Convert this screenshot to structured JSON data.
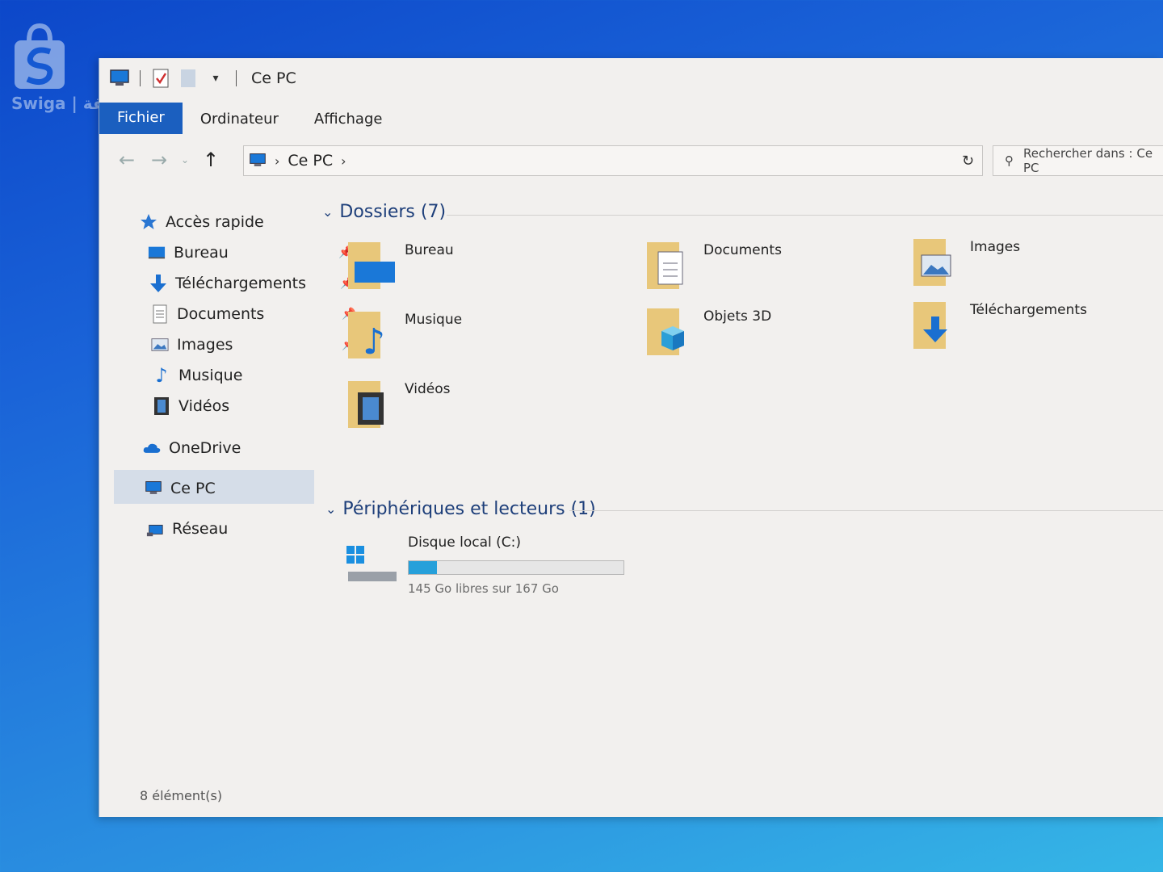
{
  "watermark": {
    "text": "Swiga | سويقة"
  },
  "window": {
    "title": "Ce PC",
    "quick_access_icons": [
      "computer-icon",
      "properties-icon",
      "new-folder-icon",
      "customize-dropdown-icon"
    ]
  },
  "ribbon": {
    "tabs": [
      {
        "label": "Fichier",
        "active": true
      },
      {
        "label": "Ordinateur",
        "active": false
      },
      {
        "label": "Affichage",
        "active": false
      }
    ]
  },
  "address": {
    "crumbs": [
      "Ce PC"
    ],
    "search_placeholder": "Rechercher dans : Ce PC"
  },
  "nav": {
    "quick_access": "Accès rapide",
    "items": [
      {
        "label": "Bureau",
        "icon": "desktop-icon",
        "pinned": true
      },
      {
        "label": "Téléchargements",
        "icon": "download-icon",
        "pinned": true
      },
      {
        "label": "Documents",
        "icon": "document-icon",
        "pinned": true
      },
      {
        "label": "Images",
        "icon": "image-icon",
        "pinned": true
      },
      {
        "label": "Musique",
        "icon": "music-icon",
        "pinned": false
      },
      {
        "label": "Vidéos",
        "icon": "video-icon",
        "pinned": false
      }
    ],
    "onedrive": "OneDrive",
    "this_pc": "Ce PC",
    "network": "Réseau"
  },
  "content": {
    "folders_header": "Dossiers (7)",
    "folders": [
      {
        "label": "Bureau",
        "icon": "desktop-folder-icon"
      },
      {
        "label": "Documents",
        "icon": "documents-folder-icon"
      },
      {
        "label": "Images",
        "icon": "images-folder-icon"
      },
      {
        "label": "Musique",
        "icon": "music-folder-icon"
      },
      {
        "label": "Objets 3D",
        "icon": "3d-objects-folder-icon"
      },
      {
        "label": "Téléchargements",
        "icon": "downloads-folder-icon"
      },
      {
        "label": "Vidéos",
        "icon": "videos-folder-icon"
      }
    ],
    "devices_header": "Périphériques et lecteurs (1)",
    "drive": {
      "label": "Disque local (C:)",
      "free_text": "145 Go libres sur 167 Go",
      "used_fraction": 0.13
    }
  },
  "status": {
    "items": "8 élément(s)"
  },
  "colors": {
    "accent": "#1b5fbf",
    "drive_bar": "#26a0da",
    "group_header": "#1e3f7a"
  }
}
